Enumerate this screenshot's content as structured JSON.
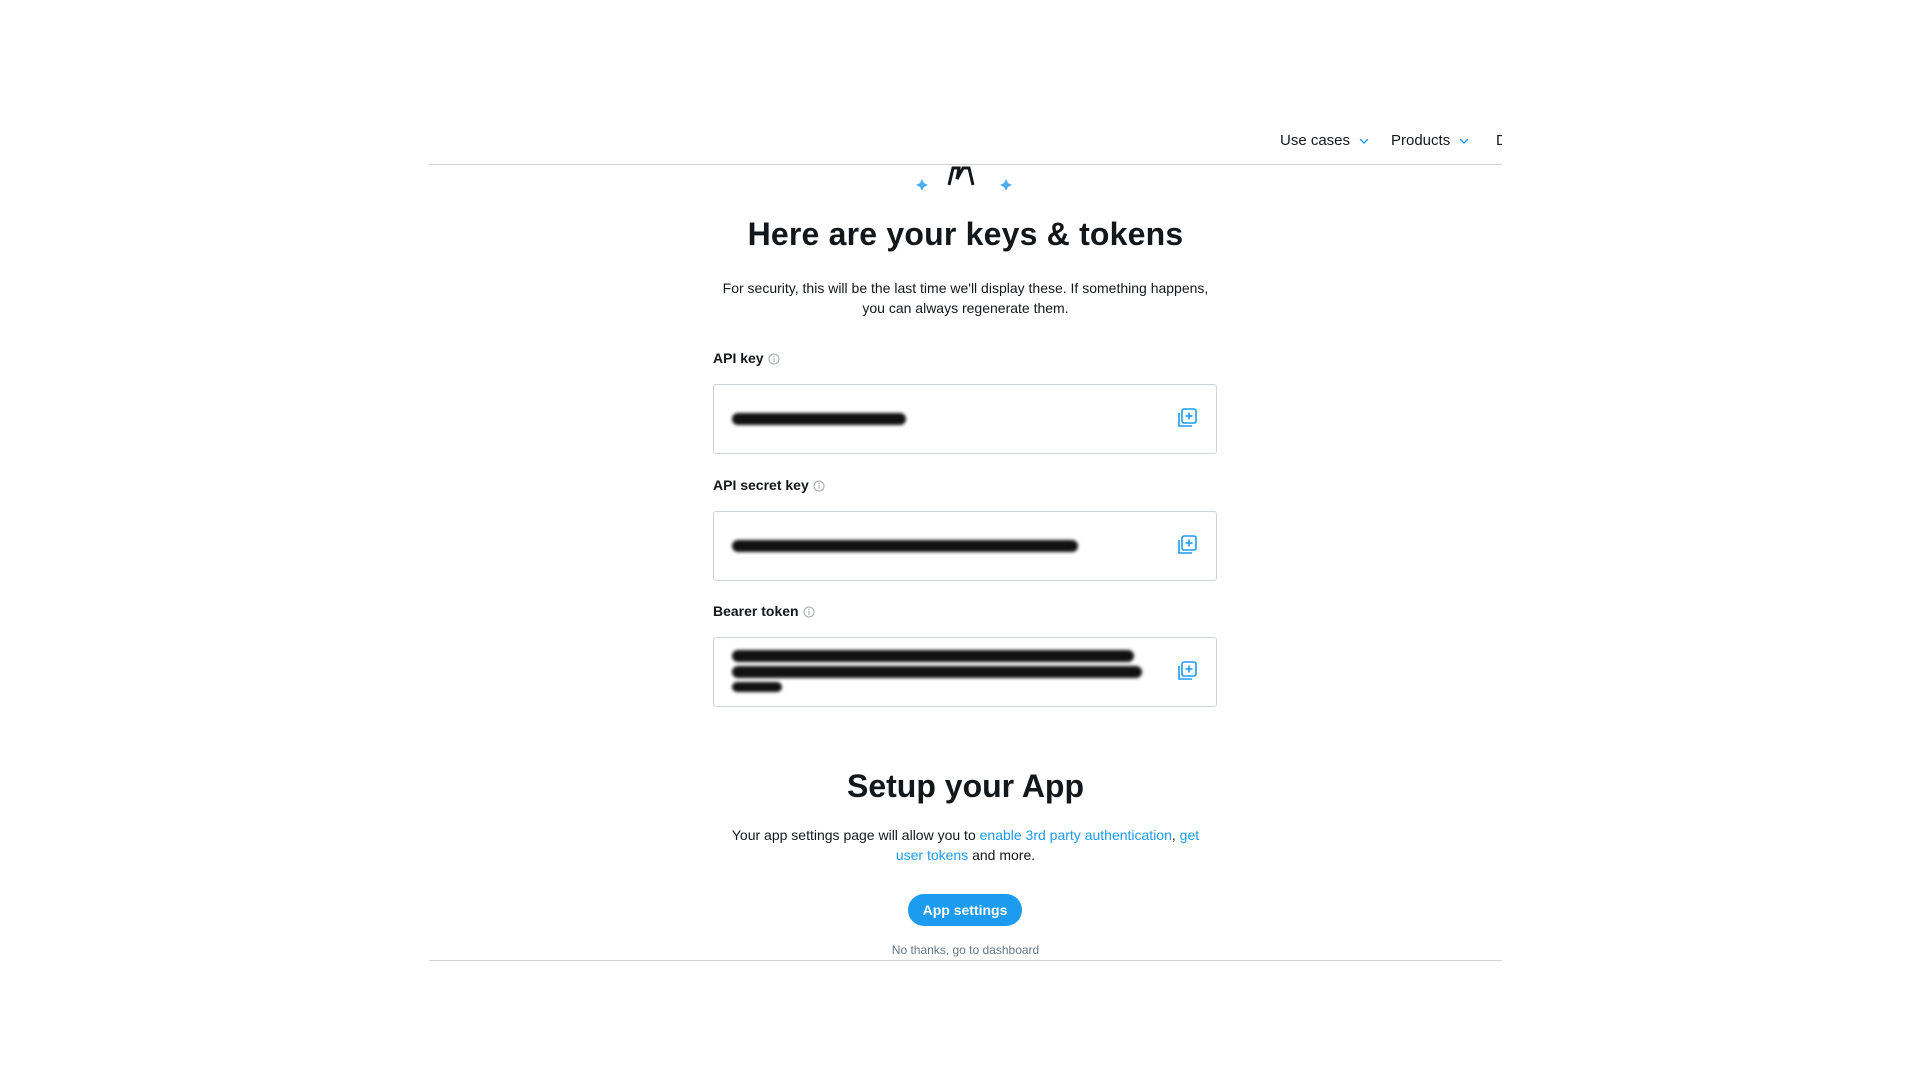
{
  "nav": {
    "items": [
      {
        "label": "Use cases",
        "icon": "chevron-down-icon"
      },
      {
        "label": "Products",
        "icon": "chevron-down-icon"
      },
      {
        "label": "D"
      }
    ]
  },
  "keys_section": {
    "title": "Here are your keys & tokens",
    "subtitle_line1": "For security, this will be the last time we'll display these. If something happens,",
    "subtitle_line2": "you can always regenerate them.",
    "fields": [
      {
        "label": "API key",
        "value": "",
        "icon": "info-icon",
        "copy_icon": "copy-icon"
      },
      {
        "label": "API secret key",
        "value": "",
        "icon": "info-icon",
        "copy_icon": "copy-icon"
      },
      {
        "label": "Bearer token",
        "value": "",
        "icon": "info-icon",
        "copy_icon": "copy-icon"
      }
    ]
  },
  "setup_section": {
    "title": "Setup your App",
    "text_before": "Your app settings page will allow you to ",
    "link1": "enable 3rd party authentication",
    "sep": ", ",
    "link2a": "get",
    "link2b": "user tokens",
    "text_after": " and more.",
    "button_label": "App settings",
    "dashboard_link": "No thanks, go to dashboard"
  },
  "colors": {
    "accent": "#1d9bf0",
    "text": "#14171a",
    "muted": "#657786",
    "border": "#cfd4d9"
  }
}
